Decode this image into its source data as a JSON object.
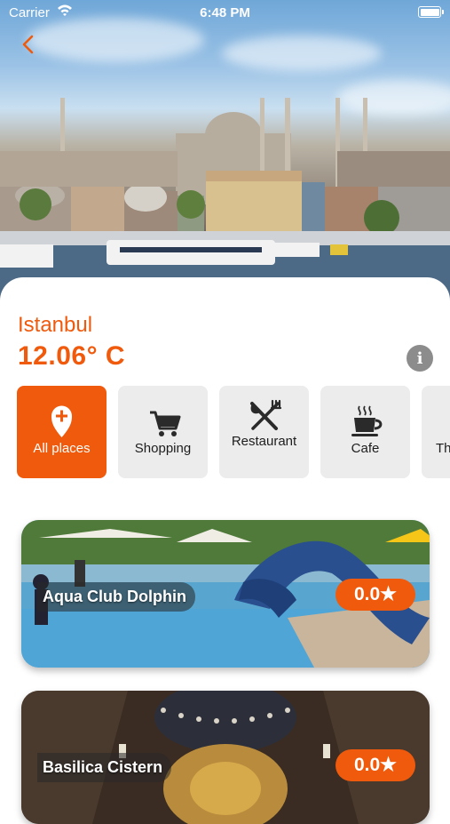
{
  "status_bar": {
    "carrier": "Carrier",
    "time": "6:48 PM"
  },
  "city": {
    "name": "Istanbul",
    "temperature": "12.06° C"
  },
  "categories": [
    {
      "label": "All places",
      "icon": "map-pin-plus-icon",
      "active": true
    },
    {
      "label": "Shopping",
      "icon": "shopping-cart-icon",
      "active": false
    },
    {
      "label": "Restaurant",
      "icon": "fork-knife-icon",
      "active": false
    },
    {
      "label": "Cafe",
      "icon": "coffee-cup-icon",
      "active": false
    },
    {
      "label": "Th",
      "icon": "partial-icon",
      "active": false
    }
  ],
  "places": [
    {
      "name": "Aqua Club Dolphin",
      "rating": "0.0★"
    },
    {
      "name": "Basilica Cistern",
      "rating": "0.0★"
    }
  ],
  "colors": {
    "accent": "#f05a0c",
    "tile": "#ececec",
    "info": "#8c8c8c"
  }
}
